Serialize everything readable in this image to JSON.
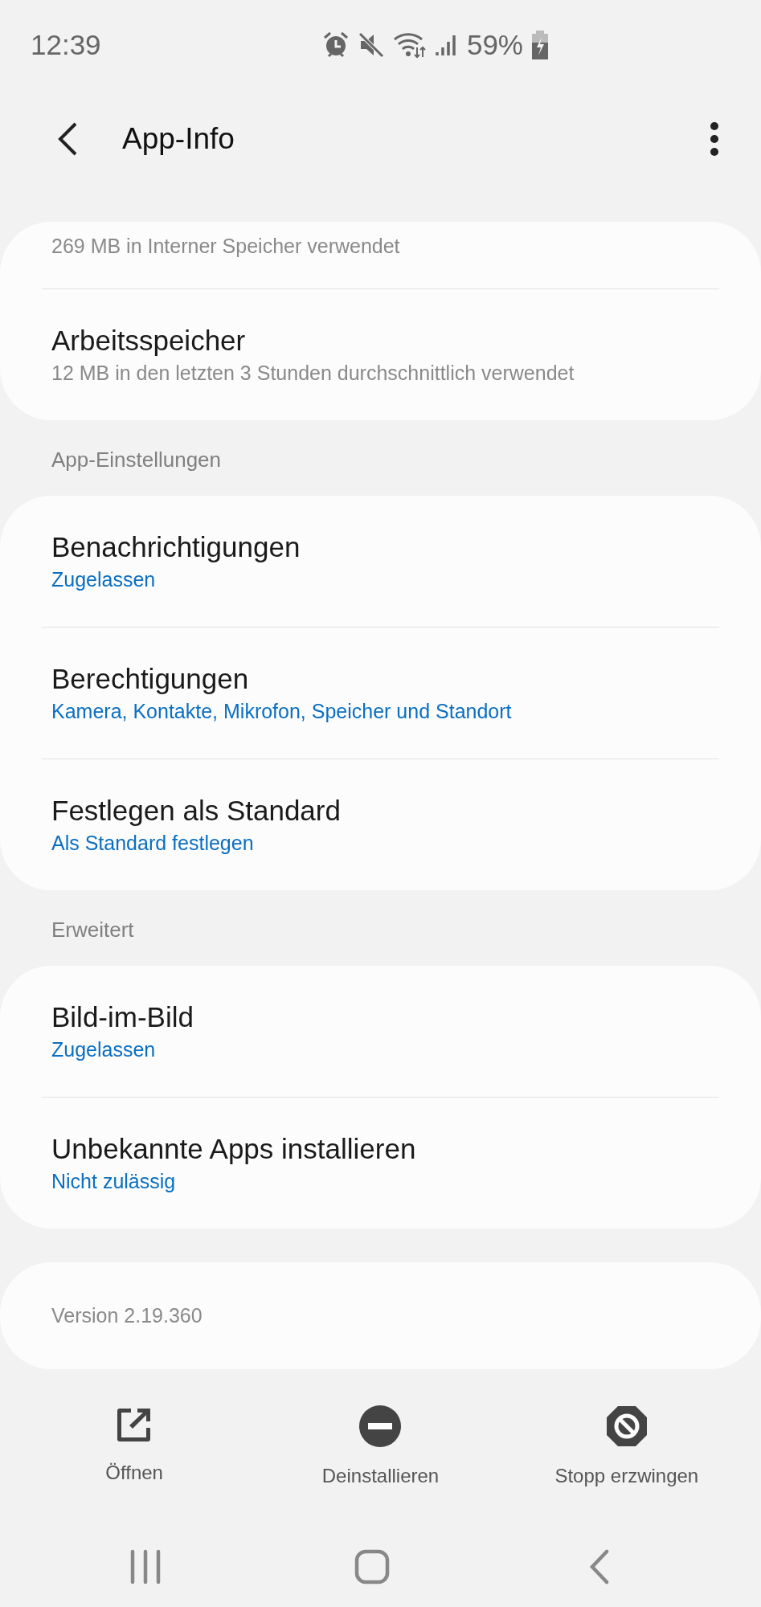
{
  "status_bar": {
    "time": "12:39",
    "battery": "59%"
  },
  "header": {
    "title": "App-Info"
  },
  "sections": [
    {
      "items": [
        {
          "kind": "partial",
          "subtitle": "269 MB in Interner Speicher verwendet",
          "link": false
        },
        {
          "kind": "row",
          "title": "Arbeitsspeicher",
          "subtitle": "12 MB in den letzten 3 Stunden durchschnittlich verwendet",
          "link": false
        }
      ]
    },
    {
      "label": "App-Einstellungen",
      "items": [
        {
          "kind": "row",
          "title": "Benachrichtigungen",
          "subtitle": "Zugelassen",
          "link": true
        },
        {
          "kind": "row",
          "title": "Berechtigungen",
          "subtitle": "Kamera, Kontakte, Mikrofon, Speicher und Standort",
          "link": true
        },
        {
          "kind": "row",
          "title": "Festlegen als Standard",
          "subtitle": "Als Standard festlegen",
          "link": true
        }
      ]
    },
    {
      "label": "Erweitert",
      "items": [
        {
          "kind": "row",
          "title": "Bild-im-Bild",
          "subtitle": "Zugelassen",
          "link": true
        },
        {
          "kind": "row",
          "title": "Unbekannte Apps installieren",
          "subtitle": "Nicht zulässig",
          "link": true
        }
      ]
    },
    {
      "items": [
        {
          "kind": "version",
          "subtitle": "Version 2.19.360",
          "link": false
        }
      ]
    }
  ],
  "actions": [
    {
      "kind": "open",
      "label": "Öffnen"
    },
    {
      "kind": "uninstall",
      "label": "Deinstallieren"
    },
    {
      "kind": "stop",
      "label": "Stopp erzwingen"
    }
  ]
}
